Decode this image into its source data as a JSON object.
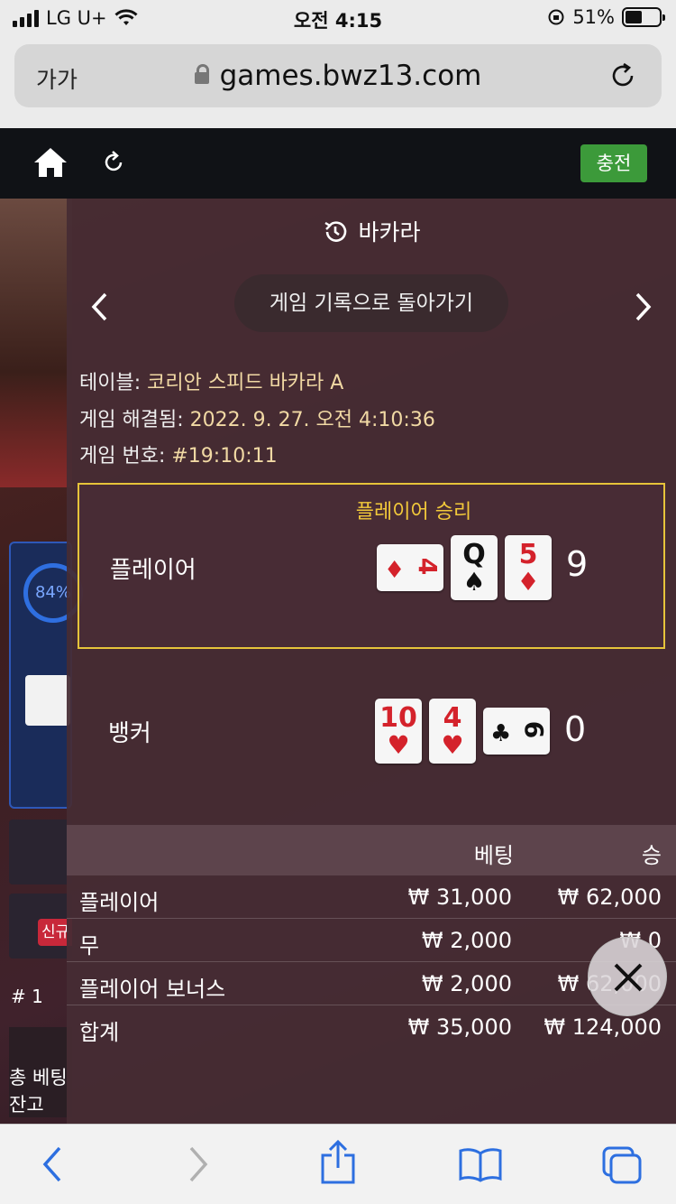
{
  "status": {
    "carrier": "LG U+",
    "time": "오전 4:15",
    "battery": "51%",
    "battery_level": 0.51
  },
  "browser": {
    "aa": "가가",
    "url": "games.bwz13.com"
  },
  "header": {
    "charge_label": "충전"
  },
  "background": {
    "ring_percent": "84%",
    "badge": "신규",
    "row_label": "# 1",
    "bottom_line1": "총 베팅",
    "bottom_line2": "잔고"
  },
  "overlay": {
    "title": "바카라",
    "back_label": "게임 기록으로 돌아가기",
    "info": [
      {
        "label": "테이블:",
        "value": "코리안 스피드 바카라 A"
      },
      {
        "label": "게임 해결됨:",
        "value": "2022. 9. 27. 오전 4:10:36"
      },
      {
        "label": "게임 번호:",
        "value": "#19:10:11"
      }
    ],
    "player": {
      "win_label": "플레이어 승리",
      "label": "플레이어",
      "score": "9",
      "cards": [
        {
          "rank": "4",
          "suit": "♦",
          "color": "red",
          "sideways": true
        },
        {
          "rank": "Q",
          "suit": "♠",
          "color": "black",
          "sideways": false
        },
        {
          "rank": "5",
          "suit": "♦",
          "color": "red",
          "sideways": false
        }
      ]
    },
    "banker": {
      "label": "뱅커",
      "score": "0",
      "cards": [
        {
          "rank": "10",
          "suit": "♥",
          "color": "red",
          "sideways": false
        },
        {
          "rank": "4",
          "suit": "♥",
          "color": "red",
          "sideways": false
        },
        {
          "rank": "6",
          "suit": "♣",
          "color": "black",
          "sideways": true
        }
      ]
    },
    "bets": {
      "col_bet": "베팅",
      "col_win": "승",
      "rows": [
        {
          "name": "플레이어",
          "bet": "₩ 31,000",
          "win": "₩ 62,000"
        },
        {
          "name": "무",
          "bet": "₩ 2,000",
          "win": "₩ 0"
        },
        {
          "name": "플레이어 보너스",
          "bet": "₩ 2,000",
          "win": "₩ 62,000"
        },
        {
          "name": "합계",
          "bet": "₩ 35,000",
          "win": "₩ 124,000"
        }
      ]
    }
  }
}
